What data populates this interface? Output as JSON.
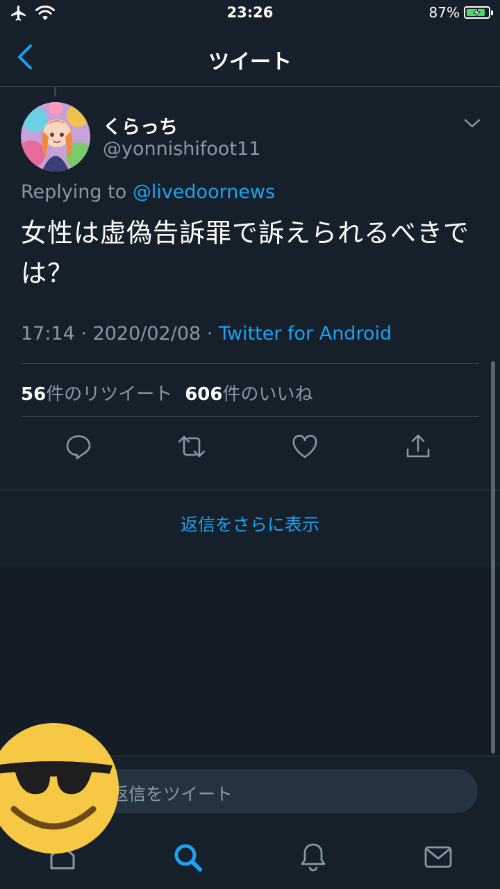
{
  "status_bar": {
    "time": "23:26",
    "battery_percent": "87%",
    "battery_level": 0.87,
    "icons": [
      "airplane-icon",
      "wifi-icon",
      "battery-charging-icon"
    ]
  },
  "nav": {
    "title": "ツイート",
    "back_icon": "chevron-left-icon"
  },
  "tweet": {
    "display_name": "くらっち",
    "handle": "@yonnishifoot11",
    "replying_prefix": "Replying to ",
    "replying_to": "@livedoornews",
    "text": "女性は虚偽告訴罪で訴えられるべきでは？",
    "time": "17:14",
    "date": "2020/02/08",
    "separator": " · ",
    "source": "Twitter for Android",
    "retweets_count": "56",
    "retweets_label": "件のリツイート",
    "likes_count": "606",
    "likes_label": "件のいいね",
    "actions": [
      "reply-icon",
      "retweet-icon",
      "like-icon",
      "share-icon"
    ]
  },
  "more_replies": "返信をさらに表示",
  "reply_bar": {
    "placeholder": "返信をツイート"
  },
  "tabs": [
    "home-icon",
    "search-icon",
    "notifications-icon",
    "messages-icon"
  ],
  "colors": {
    "background": "#15202b",
    "accent": "#1da1f2",
    "secondary_text": "#8899a6",
    "divider": "#38444d"
  }
}
